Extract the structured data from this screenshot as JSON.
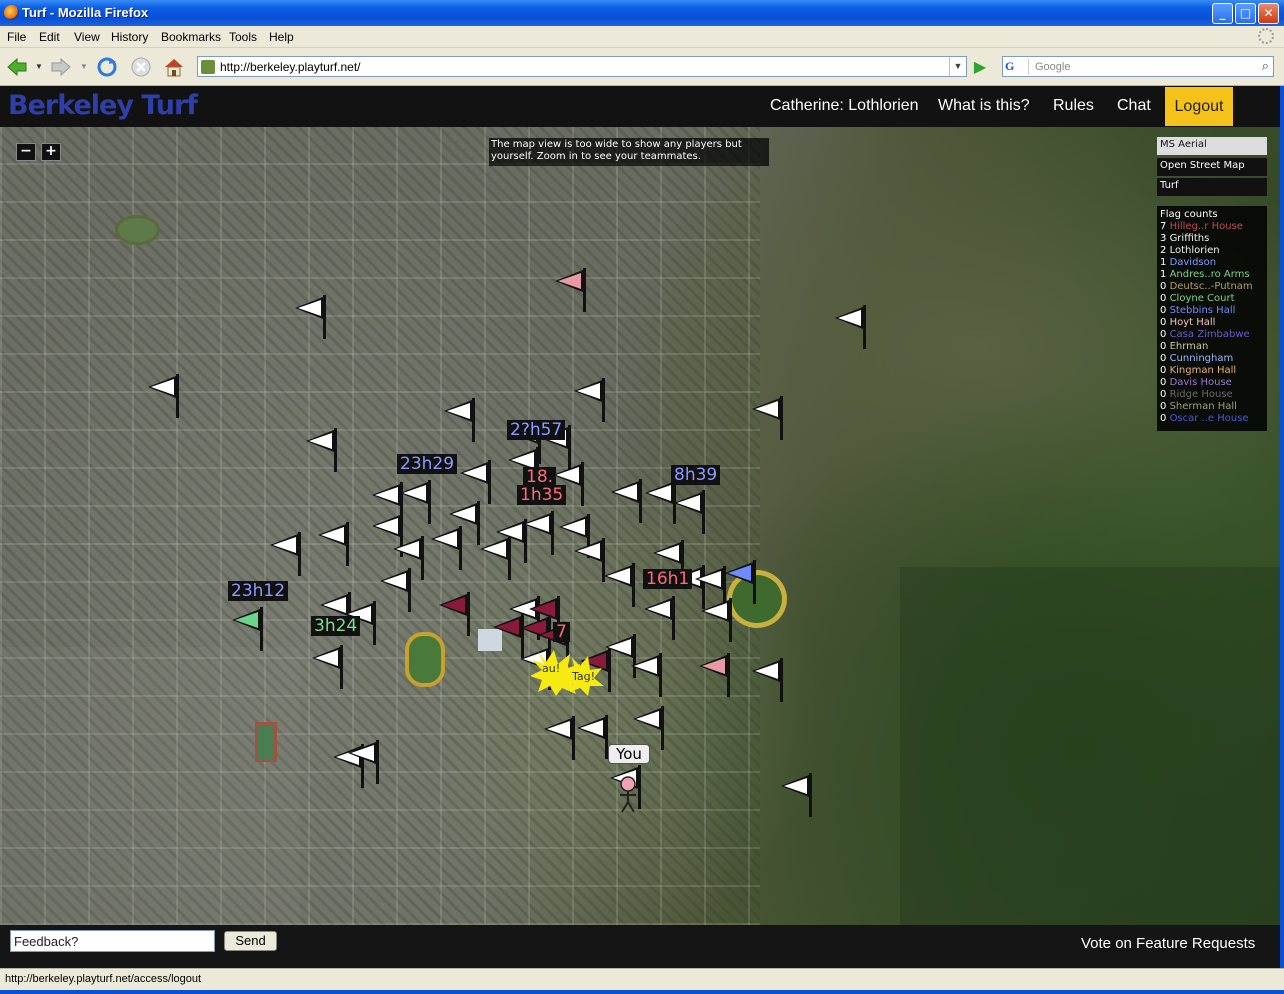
{
  "window": {
    "title": "Turf - Mozilla Firefox",
    "min": "_",
    "max": "□",
    "close": "✕"
  },
  "menu": [
    "File",
    "Edit",
    "View",
    "History",
    "Bookmarks",
    "Tools",
    "Help"
  ],
  "nav": {
    "url": "http://berkeley.playturf.net/",
    "search_placeholder": "Google",
    "search_engine_glyph": "G"
  },
  "site": {
    "logo": "Berkeley Turf",
    "user_link": "Catherine: Lothlorien",
    "what_link": "What is this?",
    "rules_link": "Rules",
    "chat_link": "Chat",
    "logout": "Logout"
  },
  "map": {
    "zoom_out": "−",
    "zoom_in": "+",
    "note": "The map view is too wide to show any players but yourself. Zoom in to see your teammates.",
    "layers": [
      {
        "label": "MS Aerial",
        "active": true
      },
      {
        "label": "Open Street Map",
        "active": false
      },
      {
        "label": "Turf",
        "active": false
      }
    ],
    "flag_counts_title": "Flag counts",
    "flag_counts": [
      {
        "count": "7",
        "name": "Hilleg..r House",
        "color": "#c04a5a"
      },
      {
        "count": "3",
        "name": "Griffiths",
        "color": "#f0f0f0"
      },
      {
        "count": "2",
        "name": "Lothlorien",
        "color": "#f0f0f0"
      },
      {
        "count": "1",
        "name": "Davidson",
        "color": "#8899ff"
      },
      {
        "count": "1",
        "name": "Andres..ro Arms",
        "color": "#7fd48a"
      },
      {
        "count": "0",
        "name": "Deutsc..-Putnam",
        "color": "#b0a060"
      },
      {
        "count": "0",
        "name": "Cloyne Court",
        "color": "#7fd48a"
      },
      {
        "count": "0",
        "name": "Stebbins Hall",
        "color": "#6f8cff"
      },
      {
        "count": "0",
        "name": "Hoyt Hall",
        "color": "#f0c0c8"
      },
      {
        "count": "0",
        "name": "Casa Zimbabwe",
        "color": "#6a5acd"
      },
      {
        "count": "0",
        "name": "Ehrman",
        "color": "#d0c8a0"
      },
      {
        "count": "0",
        "name": "Cunningham",
        "color": "#9ab8ff"
      },
      {
        "count": "0",
        "name": "Kingman Hall",
        "color": "#e8b070"
      },
      {
        "count": "0",
        "name": "Davis House",
        "color": "#9a7ad0"
      },
      {
        "count": "0",
        "name": "Ridge House",
        "color": "#6a6a6a"
      },
      {
        "count": "0",
        "name": "Sherman Hall",
        "color": "#9aa07a"
      },
      {
        "count": "0",
        "name": "Oscar ..e House",
        "color": "#4a5ad8"
      }
    ],
    "timers": [
      {
        "label": "23h29",
        "color": "#8a9cff"
      },
      {
        "label": "8h39",
        "color": "#8a9cff"
      },
      {
        "label": "1h35",
        "color": "#ff6a7a"
      },
      {
        "label": "18.",
        "color": "#ff6a7a"
      },
      {
        "label": "23h12",
        "color": "#8a9cff"
      },
      {
        "label": "3h24",
        "color": "#7fe08a"
      },
      {
        "label": "2?h57",
        "color": "#8a9cff"
      },
      {
        "label": "7",
        "color": "#ff6a7a"
      },
      {
        "label": "16h1",
        "color": "#ff6a7a"
      }
    ],
    "you_label": "You",
    "tag_labels": {
      "left": "au!",
      "right": "Tag!"
    }
  },
  "footer": {
    "feedback_value": "Feedback?",
    "send_label": "Send",
    "vote_link": "Vote on Feature Requests"
  },
  "status": {
    "text": "http://berkeley.playturf.net/access/logout"
  }
}
